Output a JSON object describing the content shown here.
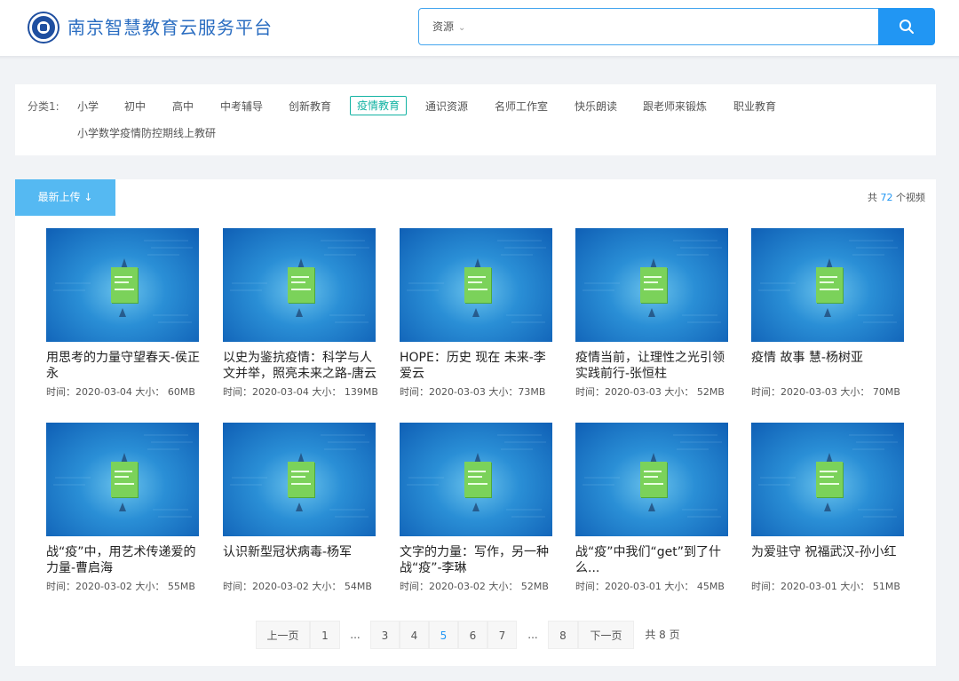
{
  "header": {
    "site_title": "南京智慧教育云服务平台",
    "search_scope": "资源",
    "search_icon": "search-icon"
  },
  "categories": {
    "label": "分类1:",
    "items": [
      "小学",
      "初中",
      "高中",
      "中考辅导",
      "创新教育",
      "疫情教育",
      "通识资源",
      "名师工作室",
      "快乐朗读",
      "跟老师来锻炼",
      "职业教育"
    ],
    "active": "疫情教育",
    "sub_items": [
      "小学数学疫情防控期线上教研"
    ]
  },
  "toolbar": {
    "sort_label": "最新上传 ↓",
    "total_prefix": "共",
    "total_count": "72",
    "total_suffix": "个视频"
  },
  "videos": [
    {
      "title": "用思考的力量守望春天-侯正永",
      "meta": "时间：2020-03-04 大小： 60MB"
    },
    {
      "title": "以史为鉴抗疫情：科学与人文并举，照亮未来之路-唐云",
      "meta": "时间：2020-03-04 大小： 139MB"
    },
    {
      "title": "HOPE：历史 现在 未来-李爱云",
      "meta": "时间：2020-03-03 大小：73MB"
    },
    {
      "title": "疫情当前，让理性之光引领实践前行-张恒柱",
      "meta": "时间：2020-03-03 大小： 52MB"
    },
    {
      "title": "疫情 故事 慧-杨树亚",
      "meta": "时间：2020-03-03 大小： 70MB"
    },
    {
      "title": "战“疫”中，用艺术传递爱的力量-曹启海",
      "meta": "时间：2020-03-02 大小： 55MB"
    },
    {
      "title": "认识新型冠状病毒-杨军",
      "meta": "时间：2020-03-02 大小： 54MB"
    },
    {
      "title": "文字的力量：写作，另一种战“疫”-李琳",
      "meta": "时间：2020-03-02 大小： 52MB"
    },
    {
      "title": "战“疫”中我们“get”到了什么...",
      "meta": "时间：2020-03-01 大小： 45MB"
    },
    {
      "title": "为爱驻守 祝福武汉-孙小红",
      "meta": "时间：2020-03-01 大小： 51MB"
    }
  ],
  "pagination": {
    "prev": "上一页",
    "next": "下一页",
    "pages": [
      "1",
      "...",
      "3",
      "4",
      "5",
      "6",
      "7",
      "...",
      "8"
    ],
    "current": "5",
    "total": "共 8 页"
  },
  "colors": {
    "accent": "#2196f3",
    "active_category": "#13b3a3",
    "sort_button": "#55b9f2",
    "title_blue": "#2a6dc1"
  }
}
